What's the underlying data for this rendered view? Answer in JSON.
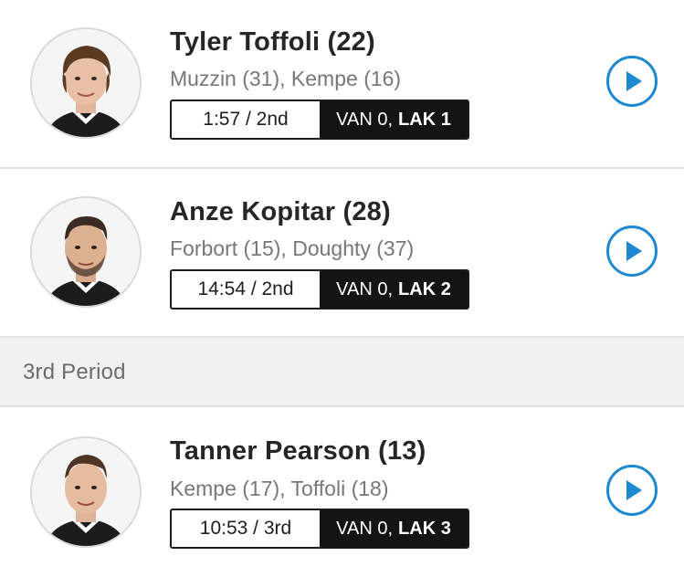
{
  "goals": [
    {
      "scorer": "Tyler Toffoli (22)",
      "assists": "Muzzin (31), Kempe (16)",
      "time": "1:57 / 2nd",
      "score_prefix": "VAN 0,",
      "score_bold": "LAK 1",
      "play_icon": "play-icon"
    },
    {
      "scorer": "Anze Kopitar (28)",
      "assists": "Forbort (15), Doughty (37)",
      "time": "14:54 / 2nd",
      "score_prefix": "VAN 0,",
      "score_bold": "LAK 2",
      "play_icon": "play-icon"
    },
    {
      "scorer": "Tanner Pearson (13)",
      "assists": "Kempe (17), Toffoli (18)",
      "time": "10:53 / 3rd",
      "score_prefix": "VAN 0,",
      "score_bold": "LAK 3",
      "play_icon": "play-icon"
    }
  ],
  "period_header": "3rd Period",
  "colors": {
    "accent_blue": "#1e88d2",
    "score_bg": "#141414",
    "divider": "#e3e3e3",
    "period_bg": "#f1f1f1"
  }
}
